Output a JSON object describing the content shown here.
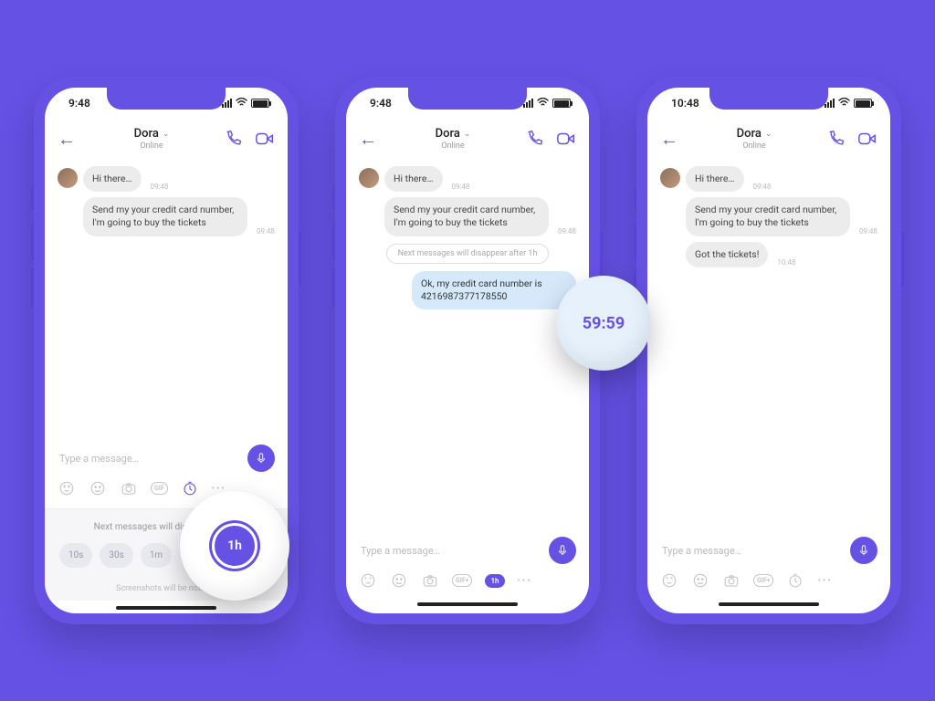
{
  "phones": [
    {
      "time": "9:48",
      "contact": "Dora",
      "status": "Online",
      "messages": {
        "m1": "Hi there…",
        "m1_ts": "09:48",
        "m2": "Send my your credit card number, I'm going to buy the tickets",
        "m2_ts": "09:48"
      },
      "placeholder": "Type a message…",
      "drawer_title": "Next messages will disappear after:",
      "chips": {
        "c1": "10s",
        "c2": "30s",
        "c3": "1m"
      },
      "drawer_foot": "Screenshots will be notified",
      "lens": "1h"
    },
    {
      "time": "9:48",
      "contact": "Dora",
      "status": "Online",
      "messages": {
        "m1": "Hi there…",
        "m1_ts": "09:48",
        "m2": "Send my your credit card number, I'm going to buy the tickets",
        "m2_ts": "09:48",
        "info": "Next messages will disappear after 1h",
        "m3": "Ok, my credit card number is 4216987377178550"
      },
      "placeholder": "Type a message…",
      "badge": "1h",
      "gif": "GIF+",
      "timer": "59:59"
    },
    {
      "time": "10:48",
      "contact": "Dora",
      "status": "Online",
      "messages": {
        "m1": "Hi there…",
        "m1_ts": "09:48",
        "m2": "Send my your credit card number, I'm going to buy the tickets",
        "m2_ts": "09:48",
        "m3": "Got the tickets!",
        "m3_ts": "10:48"
      },
      "placeholder": "Type a message…",
      "gif": "GIF+"
    }
  ]
}
